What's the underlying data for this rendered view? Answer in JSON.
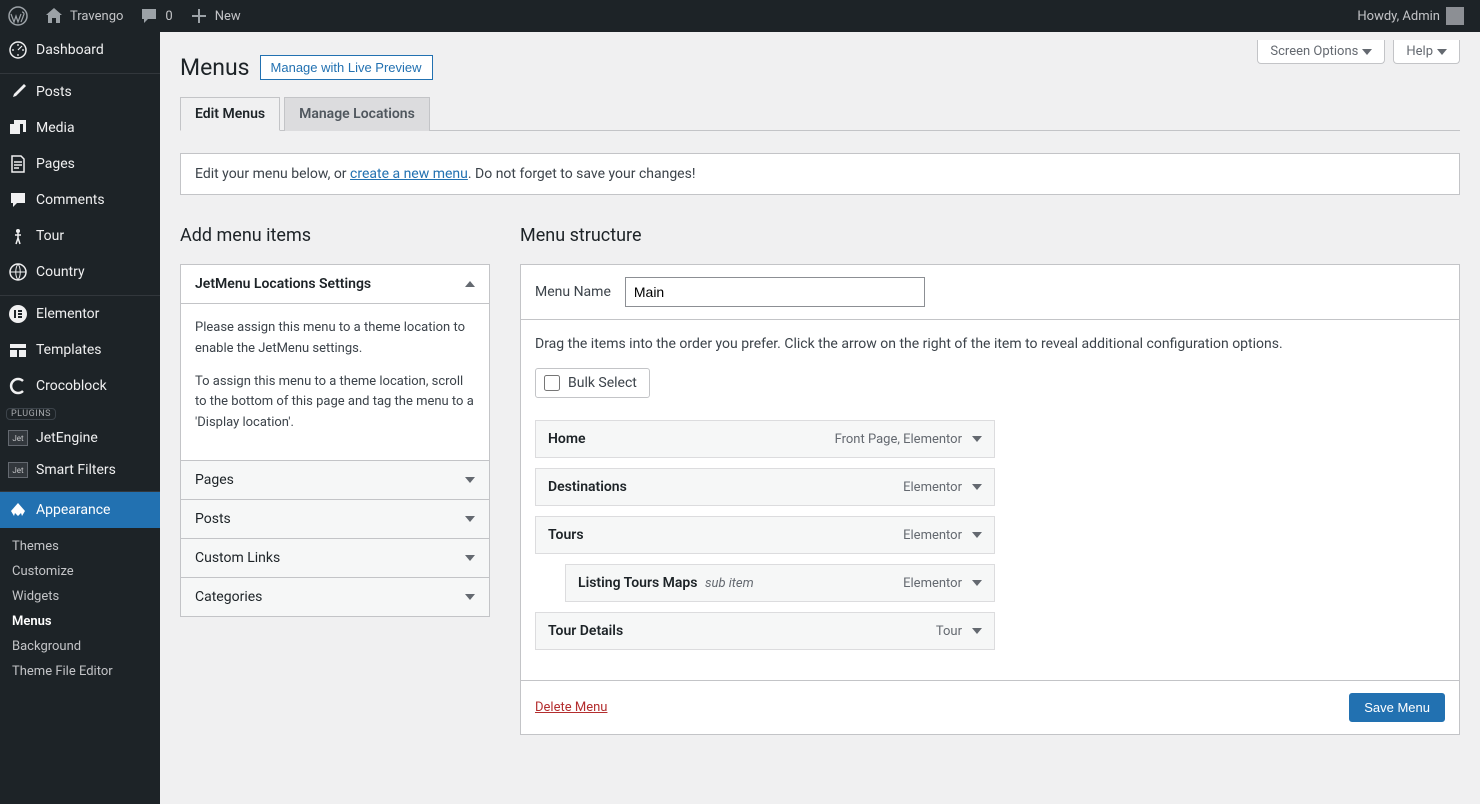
{
  "adminbar": {
    "site_name": "Travengo",
    "comments": "0",
    "new": "New",
    "howdy": "Howdy, Admin"
  },
  "sidebar": {
    "items": [
      {
        "label": "Dashboard"
      },
      {
        "label": "Posts"
      },
      {
        "label": "Media"
      },
      {
        "label": "Pages"
      },
      {
        "label": "Comments"
      },
      {
        "label": "Tour"
      },
      {
        "label": "Country"
      },
      {
        "label": "Elementor"
      },
      {
        "label": "Templates"
      },
      {
        "label": "Crocoblock"
      },
      {
        "label": "JetEngine"
      },
      {
        "label": "Smart Filters"
      },
      {
        "label": "Appearance"
      }
    ],
    "plugins_tag": "PLUGINS",
    "submenu": [
      {
        "label": "Themes"
      },
      {
        "label": "Customize"
      },
      {
        "label": "Widgets"
      },
      {
        "label": "Menus"
      },
      {
        "label": "Background"
      },
      {
        "label": "Theme File Editor"
      }
    ]
  },
  "screen": {
    "options": "Screen Options",
    "help": "Help"
  },
  "page": {
    "title": "Menus",
    "preview_btn": "Manage with Live Preview"
  },
  "tabs": {
    "edit": "Edit Menus",
    "locations": "Manage Locations"
  },
  "notice": {
    "before": "Edit your menu below, or ",
    "link": "create a new menu",
    "after": ". Do not forget to save your changes!"
  },
  "left": {
    "title": "Add menu items",
    "jetmenu_title": "JetMenu Locations Settings",
    "jetmenu_p1": "Please assign this menu to a theme location to enable the JetMenu settings.",
    "jetmenu_p2": "To assign this menu to a theme location, scroll to the bottom of this page and tag the menu to a 'Display location'.",
    "acc": [
      "Pages",
      "Posts",
      "Custom Links",
      "Categories"
    ]
  },
  "right": {
    "title": "Menu structure",
    "name_label": "Menu Name",
    "name_value": "Main",
    "help": "Drag the items into the order you prefer. Click the arrow on the right of the item to reveal additional configuration options.",
    "bulk": "Bulk Select",
    "items": [
      {
        "title": "Home",
        "type": "Front Page, Elementor",
        "sub": false
      },
      {
        "title": "Destinations",
        "type": "Elementor",
        "sub": false
      },
      {
        "title": "Tours",
        "type": "Elementor",
        "sub": false
      },
      {
        "title": "Listing Tours Maps",
        "type": "Elementor",
        "sub": true,
        "subLabel": "sub item"
      },
      {
        "title": "Tour Details",
        "type": "Tour",
        "sub": false
      }
    ],
    "delete": "Delete Menu",
    "save": "Save Menu"
  }
}
